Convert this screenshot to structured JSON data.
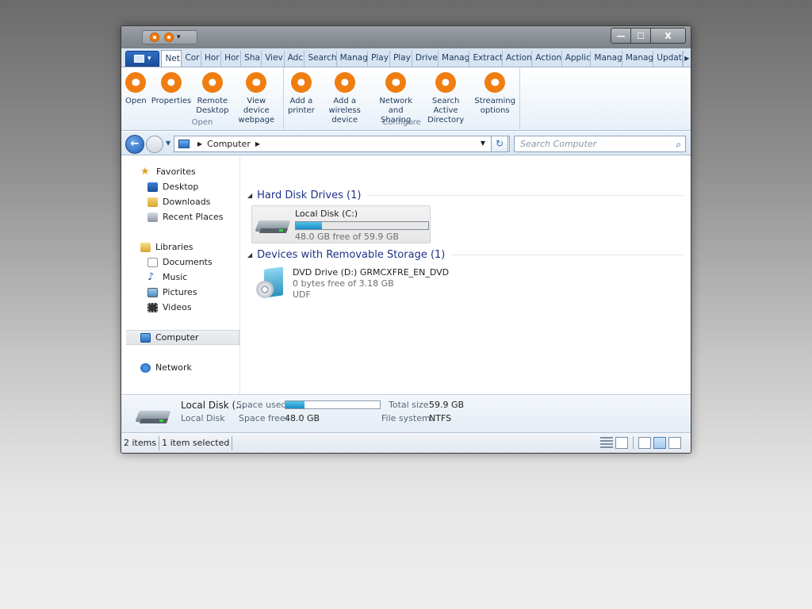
{
  "window": {
    "title_controls": {
      "minimize": "—",
      "maximize": "☐",
      "close": "X"
    }
  },
  "tabs": [
    "Net",
    "Cor",
    "Hor",
    "Hor",
    "Sha",
    "Viev",
    "Adc",
    "Search",
    "Manag",
    "Play",
    "Play",
    "Drive",
    "Manag",
    "Extract",
    "Action",
    "Action",
    "Applic",
    "Manag",
    "Manag",
    "Updat"
  ],
  "ribbon": {
    "open_group": {
      "label": "Open",
      "buttons": [
        {
          "line1": "Open",
          "line2": ""
        },
        {
          "line1": "Properties",
          "line2": ""
        },
        {
          "line1": "Remote",
          "line2": "Desktop"
        },
        {
          "line1": "View device",
          "line2": "webpage"
        }
      ]
    },
    "configure_group": {
      "label": "Configure",
      "buttons": [
        {
          "line1": "Add a",
          "line2": "printer"
        },
        {
          "line1": "Add a wireless",
          "line2": "device"
        },
        {
          "line1": "Network",
          "line2": "and Sharing"
        },
        {
          "line1": "Search Active",
          "line2": "Directory"
        },
        {
          "line1": "Streaming",
          "line2": "options"
        }
      ]
    }
  },
  "address": {
    "path": "Computer",
    "search_placeholder": "Search Computer"
  },
  "nav": {
    "favorites": "Favorites",
    "desktop": "Desktop",
    "downloads": "Downloads",
    "recent": "Recent Places",
    "libraries": "Libraries",
    "documents": "Documents",
    "music": "Music",
    "pictures": "Pictures",
    "videos": "Videos",
    "computer": "Computer",
    "network": "Network"
  },
  "content": {
    "hdd_section": "Hard Disk Drives (1)",
    "removable_section": "Devices with Removable Storage (1)",
    "local_disk": {
      "name": "Local Disk (C:)",
      "free": "48.0 GB free of 59.9 GB",
      "used_fraction": 0.199
    },
    "dvd": {
      "name": "DVD Drive (D:) GRMCXFRE_EN_DVD",
      "free": "0 bytes free of 3.18 GB",
      "fs": "UDF"
    }
  },
  "details": {
    "name": "Local Disk (...",
    "type": "Local Disk",
    "space_used_label": "Space used:",
    "space_free_label": "Space free:",
    "space_free": "48.0 GB",
    "total_size_label": "Total size:",
    "total_size": "59.9 GB",
    "file_system_label": "File system:",
    "file_system": "NTFS",
    "used_fraction": 0.199
  },
  "status": {
    "items": "2 items",
    "selected": "1 item selected"
  },
  "colors": {
    "accent_orange": "#f07c10",
    "title_blue": "#1e3287",
    "bar_blue": "#1b8dc7"
  }
}
